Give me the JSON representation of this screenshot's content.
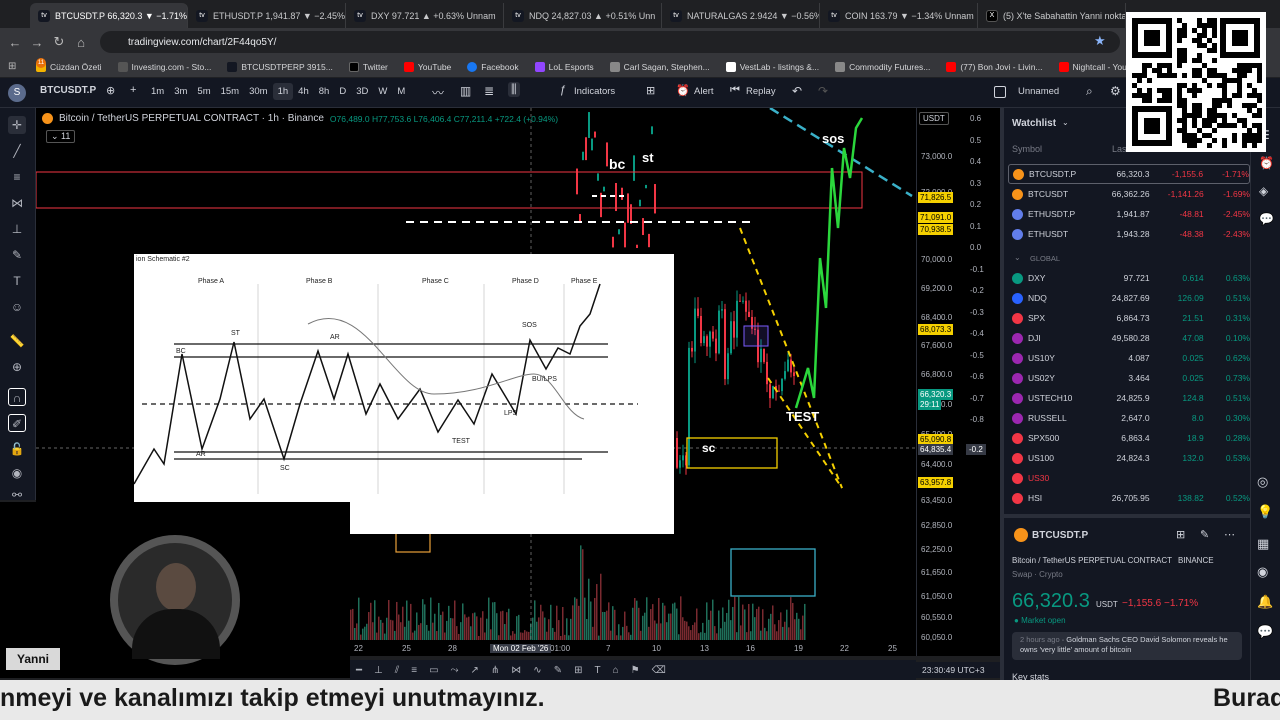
{
  "browser": {
    "tabs": [
      {
        "title": "BTCUSDT.P 66,320.3 ▼ −1.71%",
        "icon": "tradingview-icon"
      },
      {
        "title": "ETHUSDT.P 1,941.87 ▼ −2.45%",
        "icon": "tradingview-icon"
      },
      {
        "title": "DXY 97.721 ▲ +0.63% Unnam",
        "icon": "tradingview-icon"
      },
      {
        "title": "NDQ 24,827.03 ▲ +0.51% Unn",
        "icon": "tradingview-icon"
      },
      {
        "title": "NATURALGAS 2.9424 ▼ −0.56%",
        "icon": "tradingview-icon"
      },
      {
        "title": "COIN 163.79 ▼ −1.34% Unnam",
        "icon": "tradingview-icon"
      },
      {
        "title": "(5) X'te Sabahattin Yanni nokta",
        "icon": "x-icon"
      }
    ],
    "url": "tradingview.com/chart/2F44qo5Y/",
    "bookmarks": [
      "Cüzdan Özeti",
      "Investing.com - Sto...",
      "BTCUSDTPERP 3915...",
      "Twitter",
      "YouTube",
      "Facebook",
      "LoL Esports",
      "Carl Sagan, Stephen...",
      "VestLab - listings &...",
      "Commodity Futures...",
      "(77) Bon Jovi - Livin...",
      "Nightcall - YouTube"
    ]
  },
  "toolbar": {
    "symbol": "BTCUSDT.P",
    "intervals": [
      "1m",
      "3m",
      "5m",
      "15m",
      "30m",
      "1h",
      "4h",
      "8h",
      "D",
      "3D",
      "W",
      "M"
    ],
    "active_interval": "1h",
    "indicators_label": "Indicators",
    "alert_label": "Alert",
    "replay_label": "Replay",
    "layout_name": "Unnamed"
  },
  "chart": {
    "legend_title": "Bitcoin / TetherUS PERPETUAL CONTRACT · 1h · Binance",
    "ohlc": "O76,489.0 H77,753.6 L76,406.4 C77,211.4 +722.4 (+0.94%)",
    "indicator_count": "11",
    "currency": "USDT",
    "annotations": {
      "bc": "bc",
      "st": "st",
      "sos": "sos",
      "sc": "sc",
      "test": "TEST"
    },
    "price_labels": [
      "73,000.0",
      "72,000.0",
      "71,000.0",
      "70,000.0",
      "69,200.0",
      "68,400.0",
      "67,600.0",
      "66,800.0",
      "66,000.0",
      "65,200.0",
      "64,400.0",
      "63,450.0",
      "62,850.0",
      "62,250.0",
      "61,650.0",
      "61,050.0",
      "60,550.0",
      "60,050.0"
    ],
    "price_tags": [
      {
        "text": "71,826.5",
        "bg": "#f5d000",
        "fg": "#000"
      },
      {
        "text": "71,091.0",
        "bg": "#f5d000",
        "fg": "#000"
      },
      {
        "text": "70,938.5",
        "bg": "#f5d000",
        "fg": "#000"
      },
      {
        "text": "68,073.3",
        "bg": "#f5d000",
        "fg": "#000"
      },
      {
        "text": "66,320.3",
        "bg": "#089981",
        "fg": "#fff"
      },
      {
        "text": "29:11",
        "bg": "#089981",
        "fg": "#fff"
      },
      {
        "text": "65,090.8",
        "bg": "#f5d000",
        "fg": "#000"
      },
      {
        "text": "64,835.4",
        "bg": "#363a45",
        "fg": "#fff"
      },
      {
        "text": "63,957.8",
        "bg": "#f5d000",
        "fg": "#000"
      }
    ],
    "secondary_axis": [
      "0.6",
      "0.5",
      "0.4",
      "0.3",
      "0.2",
      "0.1",
      "0.0",
      "-0.1",
      "-0.2",
      "-0.3",
      "-0.4",
      "-0.5",
      "-0.6",
      "-0.7",
      "-0.8"
    ],
    "secondary_tag": "-0.2",
    "time_labels": [
      "22",
      "25",
      "28",
      "Mon 02 Feb '26",
      "01:00",
      "7",
      "10",
      "13",
      "16",
      "19",
      "22",
      "25"
    ],
    "clock": "23:30:49 UTC+3"
  },
  "schematic": {
    "title": "ion Schematic #2",
    "phases": [
      "Phase A",
      "Phase B",
      "Phase C",
      "Phase D",
      "Phase E"
    ],
    "labels": {
      "bc": "BC",
      "st": "ST",
      "ar_top": "AR",
      "sos": "SOS",
      "bu_lps": "BU/LPS",
      "lps": "LPS",
      "test": "TEST",
      "ar_bottom": "AR",
      "sc": "SC"
    }
  },
  "watchlist": {
    "title": "Watchlist",
    "columns": {
      "symbol": "Symbol",
      "last": "Last"
    },
    "section": "GLOBAL",
    "rows": [
      {
        "symbol": "BTCUSDT.P",
        "last": "66,320.3",
        "chg": "-1,155.6",
        "pct": "-1.71%",
        "dir": "neg",
        "color": "#f7931a"
      },
      {
        "symbol": "BTCUSDT",
        "last": "66,362.26",
        "chg": "-1,141.26",
        "pct": "-1.69%",
        "dir": "neg",
        "color": "#f7931a"
      },
      {
        "symbol": "ETHUSDT.P",
        "last": "1,941.87",
        "chg": "-48.81",
        "pct": "-2.45%",
        "dir": "neg",
        "color": "#627eea"
      },
      {
        "symbol": "ETHUSDT",
        "last": "1,943.28",
        "chg": "-48.38",
        "pct": "-2.43%",
        "dir": "neg",
        "color": "#627eea"
      }
    ],
    "global_rows": [
      {
        "symbol": "DXY",
        "last": "97.721",
        "chg": "0.614",
        "pct": "0.63%",
        "dir": "pos",
        "color": "#089981"
      },
      {
        "symbol": "NDQ",
        "last": "24,827.69",
        "chg": "126.09",
        "pct": "0.51%",
        "dir": "pos",
        "color": "#2962ff"
      },
      {
        "symbol": "SPX",
        "last": "6,864.73",
        "chg": "21.51",
        "pct": "0.31%",
        "dir": "pos",
        "color": "#f23645"
      },
      {
        "symbol": "DJI",
        "last": "49,580.28",
        "chg": "47.08",
        "pct": "0.10%",
        "dir": "pos",
        "color": "#9c27b0"
      },
      {
        "symbol": "US10Y",
        "last": "4.087",
        "chg": "0.025",
        "pct": "0.62%",
        "dir": "pos",
        "color": "#9c27b0"
      },
      {
        "symbol": "US02Y",
        "last": "3.464",
        "chg": "0.025",
        "pct": "0.73%",
        "dir": "pos",
        "color": "#9c27b0"
      },
      {
        "symbol": "USTECH10",
        "last": "24,825.9",
        "chg": "124.8",
        "pct": "0.51%",
        "dir": "pos",
        "color": "#9c27b0"
      },
      {
        "symbol": "RUSSELL",
        "last": "2,647.0",
        "chg": "8.0",
        "pct": "0.30%",
        "dir": "pos",
        "color": "#9c27b0"
      },
      {
        "symbol": "SPX500",
        "last": "6,863.4",
        "chg": "18.9",
        "pct": "0.28%",
        "dir": "pos",
        "color": "#f23645"
      },
      {
        "symbol": "US100",
        "last": "24,824.3",
        "chg": "132.0",
        "pct": "0.53%",
        "dir": "pos",
        "color": "#f23645"
      },
      {
        "symbol": "US30",
        "last": "",
        "chg": "",
        "pct": "",
        "dir": "pos",
        "color": "#f23645"
      },
      {
        "symbol": "HSI",
        "last": "26,705.95",
        "chg": "138.82",
        "pct": "0.52%",
        "dir": "pos",
        "color": "#f23645"
      }
    ],
    "detail": {
      "symbol": "BTCUSDT.P",
      "desc": "Bitcoin / TetherUS PERPETUAL CONTRACT",
      "exchange": "BINANCE",
      "type": "Swap · Crypto",
      "price": "66,320.3",
      "currency": "USDT",
      "change": "−1,155.6 −1.71%",
      "status": "Market open",
      "news_time": "2 hours ago",
      "news": "Goldman Sachs CEO David Solomon reveals he owns 'very little' amount of bitcoin",
      "key_stats": "Key stats"
    }
  },
  "stream": {
    "name": "Yanni",
    "ticker_left": "nmeyi ve kanalımızı takip etmeyi unutmayınız.",
    "ticker_right": "Burad"
  }
}
